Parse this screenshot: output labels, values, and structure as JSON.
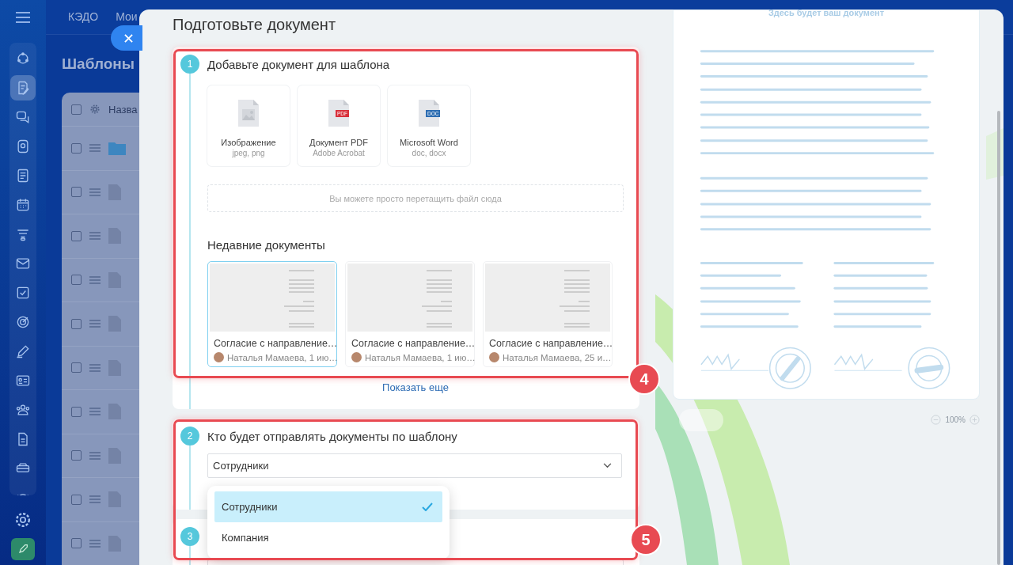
{
  "sidebar": {
    "items": [
      {
        "selected": false
      },
      {
        "selected": true
      },
      {
        "selected": false
      },
      {
        "selected": false
      },
      {
        "selected": false
      },
      {
        "selected": false
      },
      {
        "selected": false
      },
      {
        "selected": false
      },
      {
        "selected": false
      },
      {
        "selected": false
      },
      {
        "selected": false
      },
      {
        "selected": false
      },
      {
        "selected": false
      },
      {
        "selected": false
      },
      {
        "selected": false
      },
      {
        "selected": false
      }
    ]
  },
  "top_nav": {
    "items": [
      "КЭДО",
      "Мои"
    ]
  },
  "page": {
    "title": "Шаблоны",
    "table": {
      "all_checked": false,
      "columns": [
        "Назва"
      ],
      "rows": [
        {
          "kind": "folder",
          "checked": false
        },
        {
          "kind": "file",
          "checked": false
        },
        {
          "kind": "file",
          "checked": false
        },
        {
          "kind": "file",
          "checked": false
        },
        {
          "kind": "file",
          "checked": false
        },
        {
          "kind": "file",
          "checked": false
        },
        {
          "kind": "file",
          "checked": false
        },
        {
          "kind": "file",
          "checked": false
        },
        {
          "kind": "file",
          "checked": false
        },
        {
          "kind": "file",
          "checked": false
        }
      ]
    }
  },
  "panel": {
    "title": "Подготовьте документ",
    "steps": [
      {
        "kind": "upload",
        "number": "1",
        "title": "Добавьте документ для шаблона",
        "upload_options": [
          {
            "kind": "image",
            "label": "Изображение",
            "hint": "jpeg, png"
          },
          {
            "kind": "pdf",
            "label": "Документ PDF",
            "hint": "Adobe Acrobat",
            "badge": "PDF"
          },
          {
            "kind": "doc",
            "label": "Microsoft Word",
            "hint": "doc, docx",
            "badge": "DOC"
          }
        ],
        "drop_zone": "Вы можете просто перетащить файл сюда",
        "recent_title": "Недавние документы",
        "recent_docs": [
          {
            "title": "Согласие с направление…",
            "meta": "Наталья Мамаева, 1 ию…",
            "selected": true
          },
          {
            "title": "Согласие с направление…",
            "meta": "Наталья Мамаева, 1 ию…",
            "selected": false
          },
          {
            "title": "Согласие с направление…",
            "meta": "Наталья Мамаева, 25 и…",
            "selected": false
          }
        ],
        "show_more": "Показать еще"
      },
      {
        "kind": "select",
        "number": "2",
        "title": "Кто будет отправлять документы по шаблону",
        "value": "Сотрудники",
        "options": [
          {
            "label": "Сотрудники",
            "selected": true
          },
          {
            "label": "Компания",
            "selected": false
          }
        ]
      },
      {
        "kind": "collapsed",
        "number": "3"
      }
    ],
    "preview": {
      "caption": "Здесь будет ваш документ",
      "zoom": "100%"
    }
  },
  "annotations": [
    {
      "label": "4"
    },
    {
      "label": "5"
    }
  ]
}
